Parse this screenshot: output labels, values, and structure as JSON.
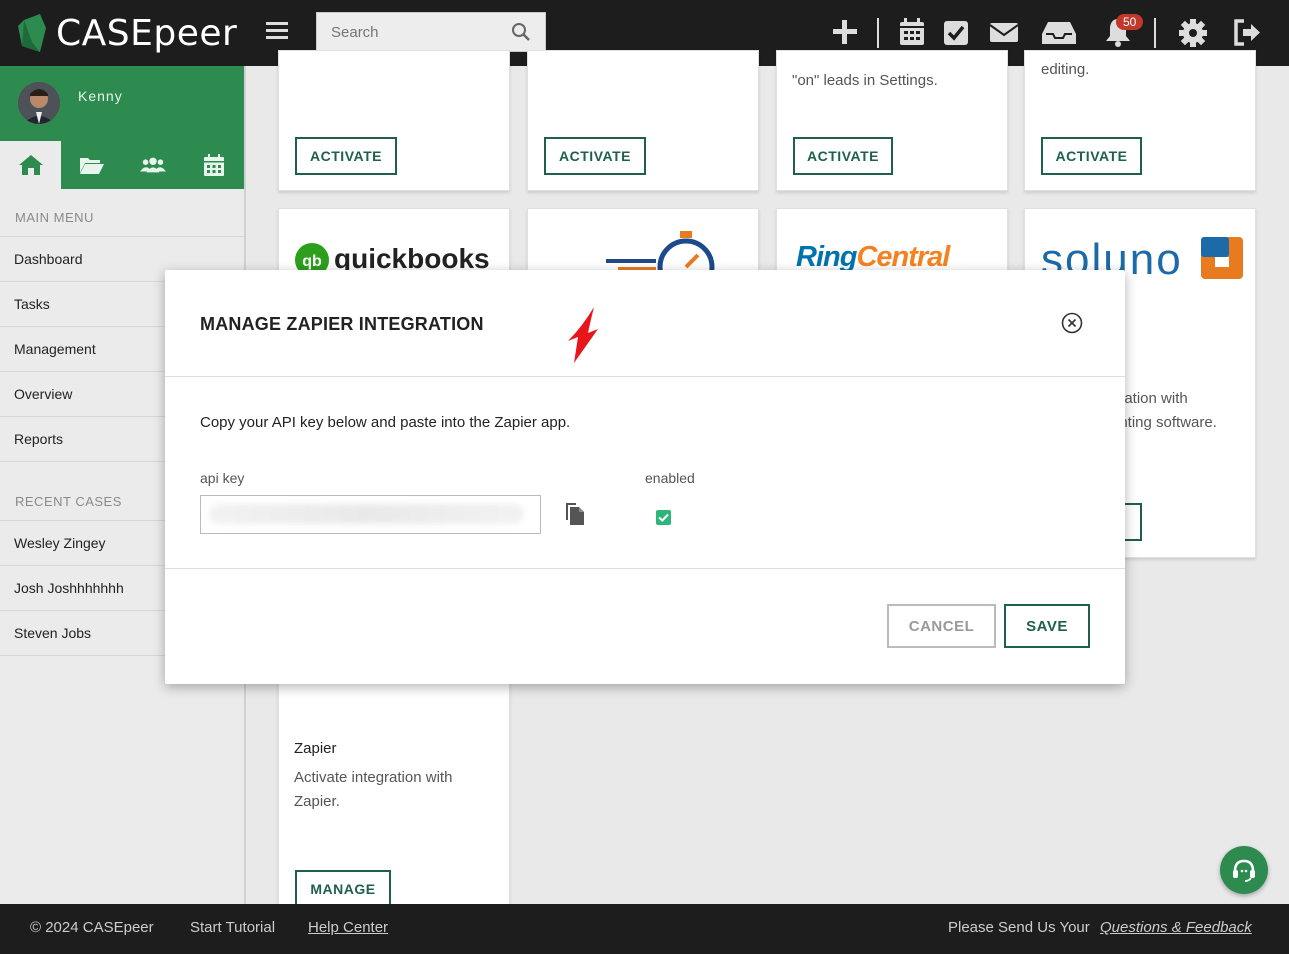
{
  "app": {
    "logo_text": "CASEpeer",
    "search_placeholder": "Search",
    "notification_count": "50"
  },
  "user": {
    "name": "Kenny"
  },
  "sidebar": {
    "main_menu_heading": "MAIN MENU",
    "menu": [
      "Dashboard",
      "Tasks",
      "Management",
      "Overview",
      "Reports"
    ],
    "recent_heading": "RECENT CASES",
    "recent_cases": [
      "Wesley Zingey",
      "Josh Joshhhhhhh",
      "Steven Jobs"
    ]
  },
  "cards": {
    "activate_label": "ACTIVATE",
    "manage_label": "MANAGE",
    "partial_text_3": "\"on\" leads in Settings.",
    "partial_text_4": "editing.",
    "quickbooks": "quickbooks",
    "ringcentral": "RingCentral",
    "soluno": "soluno",
    "soluno_text_1": "gration with",
    "soluno_text_2": "unting software.",
    "zapier_title": "Zapier",
    "zapier_desc_1": "Activate integration with",
    "zapier_desc_2": "Zapier."
  },
  "modal": {
    "title": "MANAGE ZAPIER INTEGRATION",
    "description": "Copy your API key below and paste into the Zapier app.",
    "api_key_label": "api key",
    "api_key_value": "",
    "enabled_label": "enabled",
    "enabled": true,
    "cancel_label": "CANCEL",
    "save_label": "SAVE"
  },
  "footer": {
    "copyright": "© 2024 CASEpeer",
    "start_tutorial": "Start Tutorial",
    "help_center": "Help Center",
    "feedback_prefix": "Please Send Us Your",
    "feedback_link": "Questions & Feedback"
  },
  "colors": {
    "brand_green": "#2e8b4f",
    "dark_green": "#1f5f4f",
    "topbar": "#1d1d1d",
    "badge": "#c0392b"
  }
}
